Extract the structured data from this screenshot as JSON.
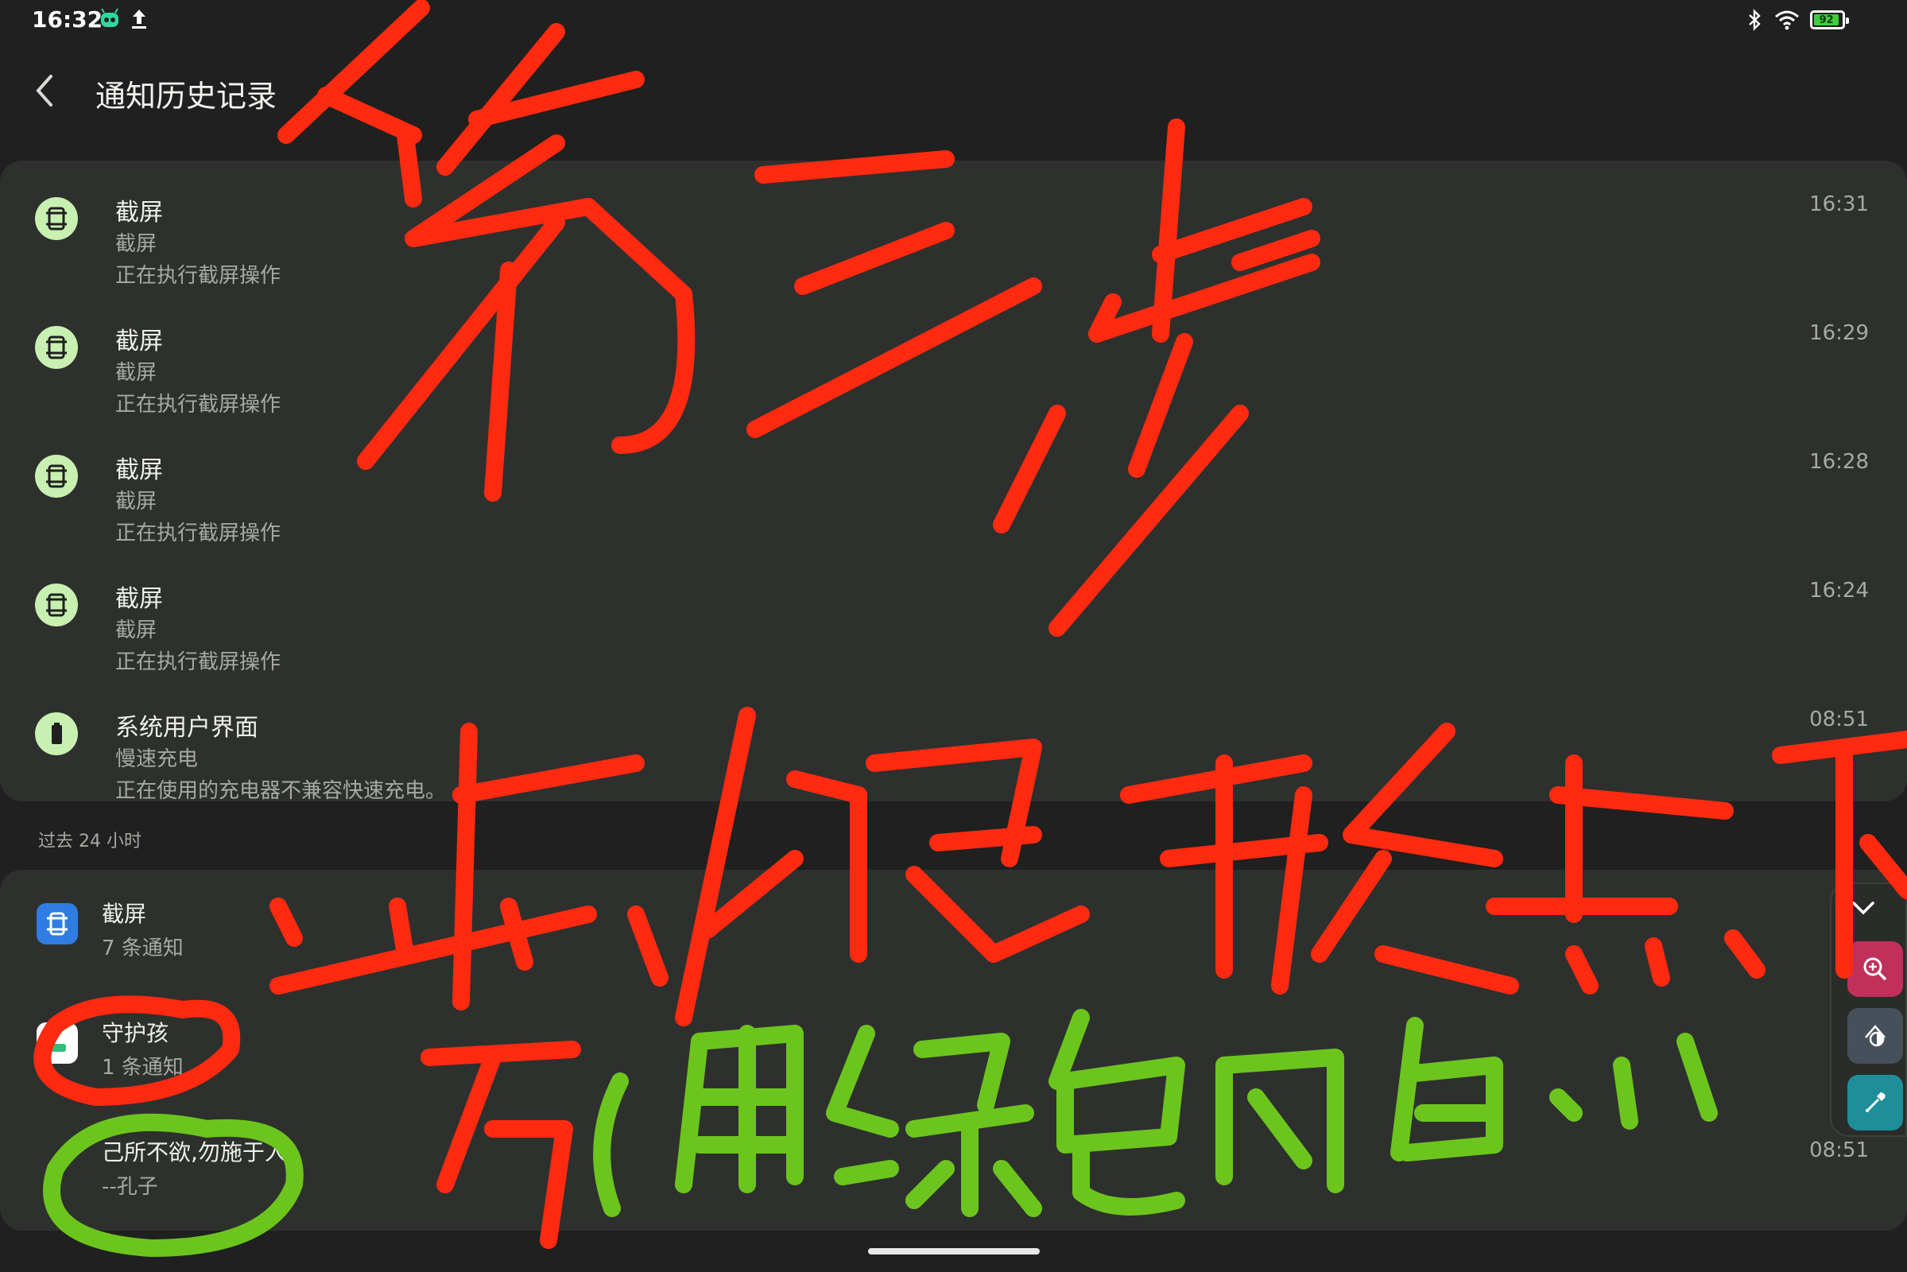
{
  "status_bar": {
    "time": "16:32",
    "battery_level": "92",
    "icons": [
      "robot-icon",
      "upload-icon",
      "bluetooth-icon",
      "wifi-icon",
      "battery-icon"
    ]
  },
  "header": {
    "title": "通知历史记录",
    "back_icon": "chevron-left-icon"
  },
  "recent": [
    {
      "app": "截屏",
      "title": "截屏",
      "text": "正在执行截屏操作",
      "time": "16:31",
      "icon": "screenshot-icon"
    },
    {
      "app": "截屏",
      "title": "截屏",
      "text": "正在执行截屏操作",
      "time": "16:29",
      "icon": "screenshot-icon"
    },
    {
      "app": "截屏",
      "title": "截屏",
      "text": "正在执行截屏操作",
      "time": "16:28",
      "icon": "screenshot-icon"
    },
    {
      "app": "截屏",
      "title": "截屏",
      "text": "正在执行截屏操作",
      "time": "16:24",
      "icon": "screenshot-icon"
    },
    {
      "app": "系统用户界面",
      "title": "慢速充电",
      "text": "正在使用的充电器不兼容快速充电。",
      "time": "08:51",
      "icon": "battery-icon"
    }
  ],
  "section_past24": "过去 24 小时",
  "grouped": [
    {
      "app": "截屏",
      "sub": "7 条通知",
      "time": "",
      "icon": "screenshot-app-icon",
      "color": "#2f7de1"
    },
    {
      "app": "守护孩",
      "sub": "1 条通知",
      "time": "",
      "icon": "guardian-app-icon",
      "color": "#ffffff"
    },
    {
      "app": "己所不欲,勿施于人",
      "sub": "--孔子",
      "time": "08:51",
      "icon": "",
      "color": ""
    }
  ],
  "side_tools": {
    "icons": [
      "chevron-down-icon",
      "zoom-in-icon",
      "contrast-icon",
      "eyedropper-icon"
    ]
  },
  "annotations": {
    "red_text": [
      "第三步",
      "点击展开后点下",
      "方"
    ],
    "green_text": [
      "(用绿色圈的)"
    ],
    "red_color": "#ff2a10",
    "green_color": "#6cc51d"
  },
  "colors": {
    "background": "#1f201f",
    "card": "#2e302e",
    "icon_bg": "#c8f0b0",
    "text_primary": "#eef0eb",
    "text_secondary": "#a6aaa3"
  }
}
